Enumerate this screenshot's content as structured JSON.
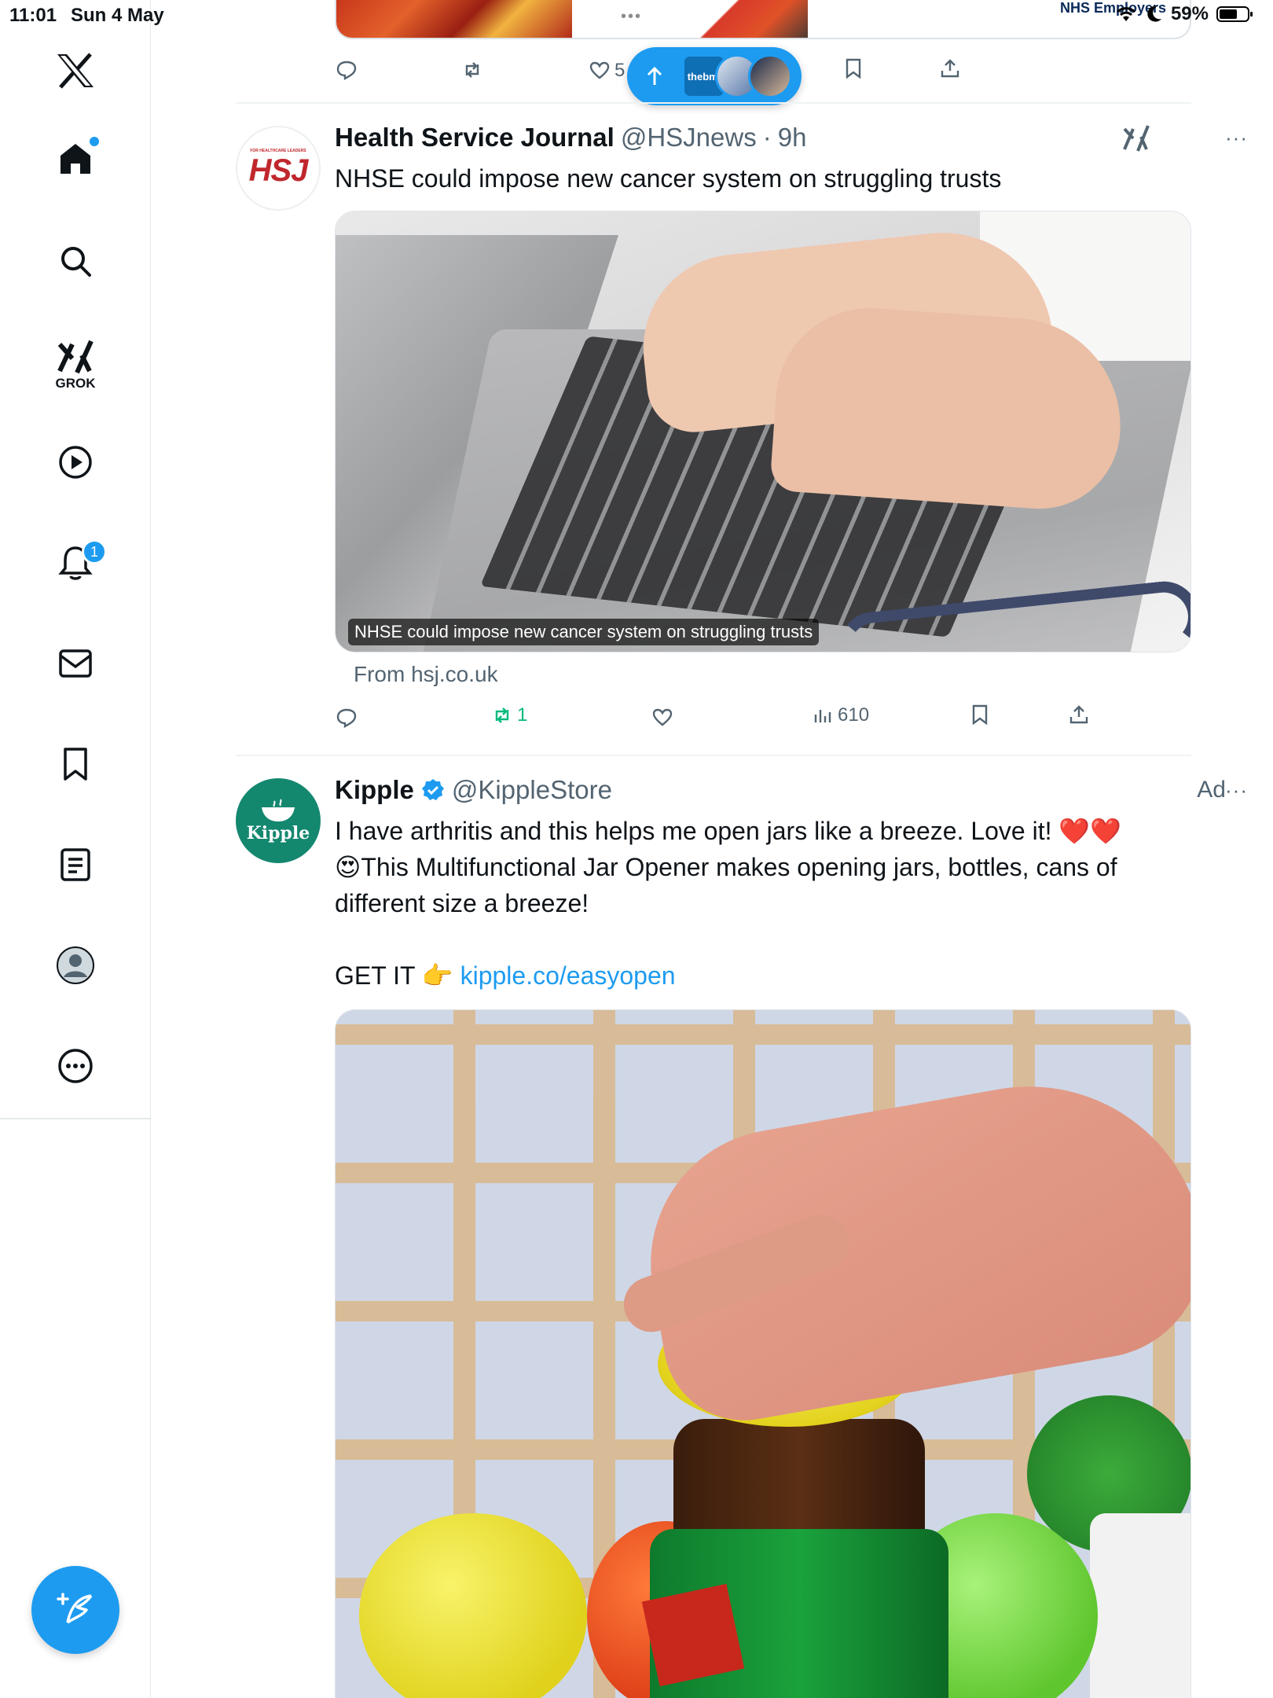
{
  "status_bar": {
    "time": "11:01",
    "date": "Sun 4 May",
    "battery": "59%",
    "dots": "•••"
  },
  "sidebar": {
    "items": [
      {
        "name": "home",
        "icon": "home-icon"
      },
      {
        "name": "search",
        "icon": "search-icon"
      },
      {
        "name": "grok",
        "icon": "grok-icon",
        "label": "GROK"
      },
      {
        "name": "video",
        "icon": "play-icon"
      },
      {
        "name": "notifications",
        "icon": "bell-icon",
        "badge": "1"
      },
      {
        "name": "messages",
        "icon": "mail-icon"
      },
      {
        "name": "bookmarks",
        "icon": "bookmark-icon"
      },
      {
        "name": "lists",
        "icon": "list-icon"
      },
      {
        "name": "profile",
        "icon": "profile-icon"
      },
      {
        "name": "more",
        "icon": "more-icon"
      }
    ],
    "compose_icon": "compose-icon"
  },
  "previous_tweet": {
    "media_brand": "NHS Employers",
    "likes": "5"
  },
  "new_posts_pill": {
    "icon": "arrow-up-icon",
    "avatar_text": "thebmj"
  },
  "tweets": [
    {
      "name": "Health Service Journal",
      "handle": "@HSJnews",
      "time": "9h",
      "avatar_text": "HSJ",
      "avatar_small_text": "FOR HEALTHCARE LEADERS",
      "text": "NHSE could impose new cancer system on struggling trusts",
      "card_caption": "NHSE could impose new cancer system on struggling trusts",
      "card_source": "From hsj.co.uk",
      "retweets": "1",
      "views": "610",
      "more": "···"
    },
    {
      "name": "Kipple",
      "handle": "@KippleStore",
      "ad_label": "Ad",
      "avatar_text": "Kipple",
      "text_line1": "I have arthritis and this helps me open jars like a breeze. Love it! ❤️❤️",
      "text_line2": "😍This Multifunctional Jar Opener makes opening jars, bottles, cans of different size a breeze!",
      "cta": "GET IT 👉",
      "link": "kipple.co/easyopen",
      "more": "···"
    }
  ],
  "colors": {
    "accent": "#1d9bf0",
    "retweet_green": "#00ba7c",
    "muted": "#536471",
    "heart_red": "#e0245e"
  }
}
